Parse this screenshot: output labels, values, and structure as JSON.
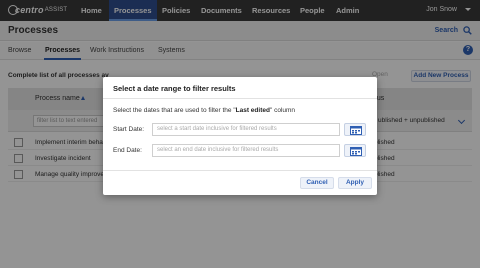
{
  "app": {
    "logo_text_1": "centro",
    "logo_text_2": "ASSIST",
    "nav": [
      "Home",
      "Processes",
      "Policies",
      "Documents",
      "Resources",
      "People",
      "Admin"
    ],
    "user": "Jon Snow"
  },
  "page": {
    "title": "Processes",
    "search_label": "Search",
    "tabs": [
      "Browse",
      "Processes",
      "Work Instructions",
      "Systems"
    ],
    "help_icon": "?"
  },
  "list": {
    "description": "Complete list of all processes av",
    "open_label": "Open",
    "add_label": "Add New Process",
    "col_name": "Process name",
    "col_status": "atus",
    "filter_placeholder": "filter list to text entered",
    "status_filter_value": "ublished + unpublished",
    "rows": [
      {
        "name": "Implement interim beha",
        "status": "blished"
      },
      {
        "name": "Investigate incident",
        "status": "blished"
      },
      {
        "name": "Manage quality improve",
        "status": "blished"
      }
    ]
  },
  "modal": {
    "title": "Select a date range to filter results",
    "desc_prefix": "Select the dates that are used to filter the \"",
    "desc_bold": "Last edited",
    "desc_suffix": "\" column",
    "start_label": "Start Date:",
    "start_placeholder": "select a start date inclusive for filtered results",
    "end_label": "End Date:",
    "end_placeholder": "select an end date inclusive for filtered results",
    "cancel_label": "Cancel",
    "apply_label": "Apply",
    "calendar_icon": "calendar-icon"
  },
  "colors": {
    "nav_bg": "#3a3a3a",
    "accent": "#2f5fb3",
    "overlay": "rgba(0,0,0,0.42)"
  }
}
